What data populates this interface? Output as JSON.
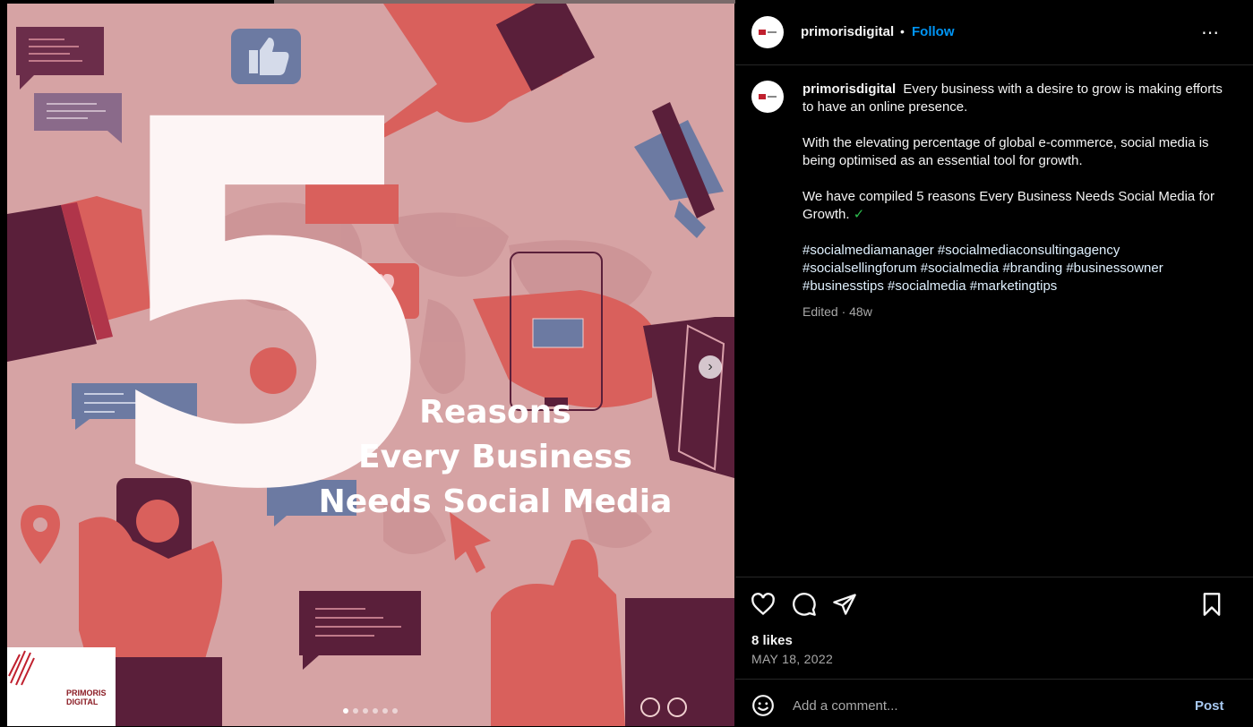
{
  "post": {
    "headline_number": "5",
    "headline_lines": [
      "Reasons",
      "Every Business",
      "Needs Social Media"
    ],
    "brand_logo_line1": "PRIMORIS",
    "brand_logo_line2": "DIGITAL",
    "carousel_index": 1,
    "carousel_count": 6
  },
  "header": {
    "username": "primorisdigital",
    "separator": "•",
    "follow_label": "Follow",
    "more_icon": "⋯"
  },
  "caption": {
    "username": "primorisdigital",
    "p1": "Every business with a desire to grow is making efforts to have an online presence.",
    "p2": "With the elevating percentage of global e-commerce, social media is being optimised as an essential tool for growth.",
    "p3": "We have compiled 5 reasons Every Business Needs Social Media for Growth.",
    "check": "✓",
    "hashtags": "#socialmediamanager #socialmediaconsultingagency #socialsellingforum #socialmedia #branding #businessowner #businesstips #socialmedia #marketingtips",
    "meta": "Edited · 48w"
  },
  "actions": {
    "like_icon": "heart-icon",
    "comment_icon": "comment-icon",
    "share_icon": "send-icon",
    "save_icon": "bookmark-icon"
  },
  "stats": {
    "likes": "8 likes",
    "date": "MAY 18, 2022"
  },
  "comment": {
    "placeholder": "Add a comment...",
    "post_label": "Post"
  },
  "colors": {
    "accent": "#0095f6",
    "media_bg": "#d6a3a4",
    "maroon": "#5a1f3a",
    "coral": "#d9605c"
  }
}
